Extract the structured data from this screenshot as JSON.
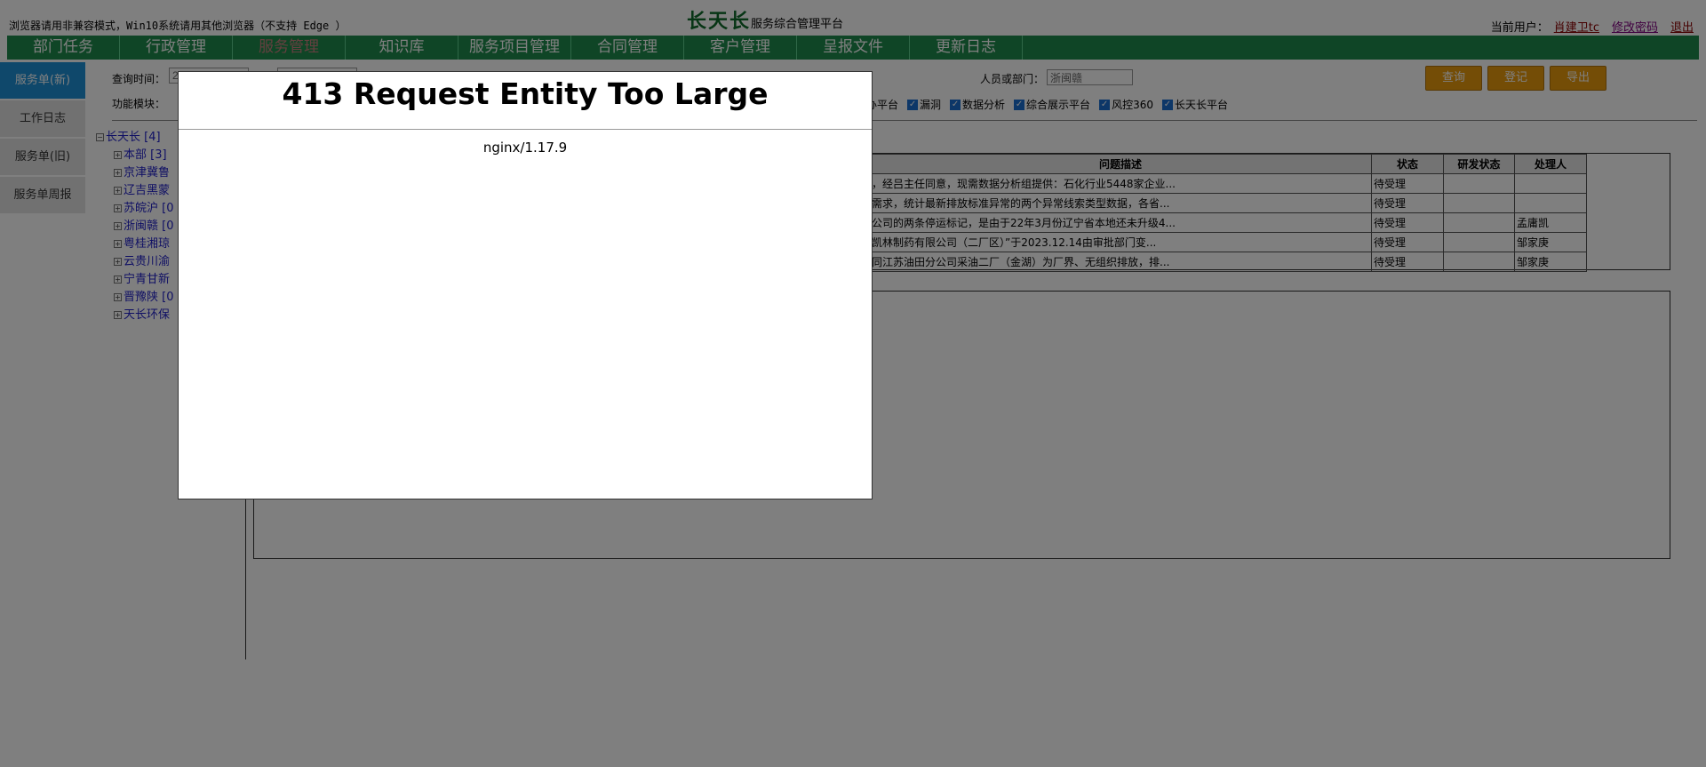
{
  "header": {
    "notice": "浏览器请用非兼容模式，Win10系统请用其他浏览器（不支持 Edge ）",
    "logo": "长天长",
    "subtitle": "服务综合管理平台",
    "user_label": "当前用户：",
    "user_name": "肖建卫tc",
    "change_password": "修改密码",
    "logout": "退出"
  },
  "nav": {
    "items": [
      "部门任务",
      "行政管理",
      "服务管理",
      "知识库",
      "服务项目管理",
      "合同管理",
      "客户管理",
      "呈报文件",
      "更新日志"
    ],
    "active_index": 2
  },
  "sidebar": {
    "items": [
      "服务单(新)",
      "工作日志",
      "服务单(旧)",
      "服务单周报"
    ],
    "active_index": 0
  },
  "filters": {
    "query_time_label": "查询时间：",
    "query_time_value": "2",
    "function_module_label": "功能模块：",
    "person_label": "人员或部门：",
    "person_value": "浙闽赣",
    "modules": [
      {
        "label": "办平台",
        "checked": true
      },
      {
        "label": "漏洞",
        "checked": true
      },
      {
        "label": "数据分析",
        "checked": true
      },
      {
        "label": "综合展示平台",
        "checked": true
      },
      {
        "label": "风控360",
        "checked": true
      },
      {
        "label": "长天长平台",
        "checked": true
      }
    ]
  },
  "buttons": {
    "query": "查询",
    "register": "登记",
    "export": "导出"
  },
  "tree": {
    "root": "长天长 [4]",
    "nodes": [
      "本部 [3]",
      "京津冀鲁",
      "辽吉黑蒙",
      "苏皖沪 [0",
      "浙闽赣 [0",
      "粤桂湘琼",
      "云贵川渝",
      "宁青甘新",
      "晋豫陕 [0",
      "天长环保"
    ]
  },
  "table": {
    "headers": [
      "问题描述",
      "状态",
      "研发状态",
      "处理人"
    ],
    "rows": [
      [
        "，经吕主任同意，现需数据分析组提供：石化行业5448家企业...",
        "待受理",
        "",
        ""
      ],
      [
        "需求，统计最新排放标准异常的两个异常线索类型数据，各省...",
        "待受理",
        "",
        ""
      ],
      [
        "公司的两条停运标记，是由于22年3月份辽宁省本地还未升级4...",
        "待受理",
        "",
        "孟庸凯"
      ],
      [
        "凯林制药有限公司（二厂区）”于2023.12.14由审批部门变...",
        "待受理",
        "",
        "邹家庚"
      ],
      [
        "同江苏油田分公司采油二厂（金湖）为厂界、无组织排放，排...",
        "待受理",
        "",
        "邹家庚"
      ]
    ]
  },
  "error_modal": {
    "title": "413 Request Entity Too Large",
    "server": "nginx/1.17.9"
  }
}
